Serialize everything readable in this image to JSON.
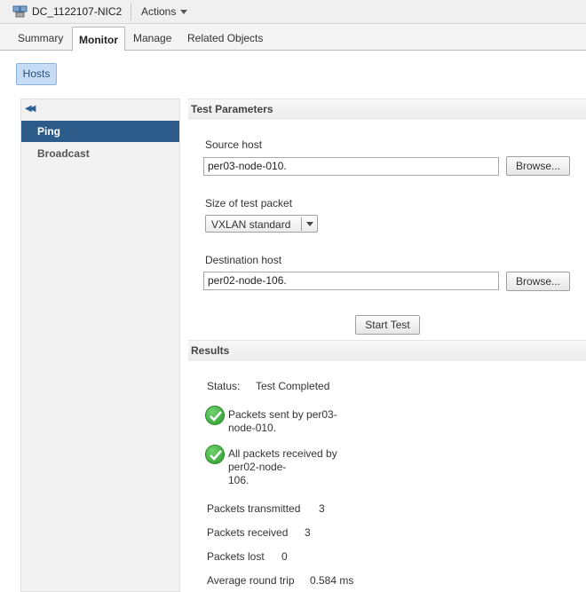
{
  "window": {
    "title": "DC_1122107-NIC2",
    "actions_label": "Actions",
    "object_icon": "network-object-icon"
  },
  "tabs": [
    {
      "label": "Summary"
    },
    {
      "label": "Monitor"
    },
    {
      "label": "Manage"
    },
    {
      "label": "Related Objects"
    }
  ],
  "active_tab": "Monitor",
  "subnav": {
    "hosts_label": "Hosts"
  },
  "sidebar": {
    "collapse_icon": "double-chevron-left-icon",
    "items": [
      {
        "label": "Ping",
        "selected": true
      },
      {
        "label": "Broadcast",
        "selected": false
      }
    ]
  },
  "test_params": {
    "header": "Test Parameters",
    "source_host_label": "Source host",
    "source_host_value": "per03-node-010.",
    "browse_label": "Browse...",
    "packet_size_label": "Size of test packet",
    "packet_size_value": "VXLAN standard",
    "dest_host_label": "Destination host",
    "dest_host_value": "per02-node-106.",
    "start_test_label": "Start Test"
  },
  "results": {
    "header": "Results",
    "status_label": "Status:",
    "status_value": "Test Completed",
    "messages": [
      {
        "lines": [
          "Packets sent by per03-",
          "node-010."
        ],
        "icon": "success-check-icon"
      },
      {
        "lines": [
          "All packets received by",
          "per02-node-",
          "106."
        ],
        "icon": "success-check-icon"
      }
    ],
    "stats": [
      {
        "label": "Packets transmitted",
        "value": "3"
      },
      {
        "label": "Packets received",
        "value": "3"
      },
      {
        "label": "Packets lost",
        "value": "0"
      },
      {
        "label": "Average round trip",
        "value": "0.584 ms"
      }
    ]
  },
  "colors": {
    "accent": "#2d5b8a",
    "success": "#2e9a2e",
    "hosts_button": "#c7ddf5"
  }
}
